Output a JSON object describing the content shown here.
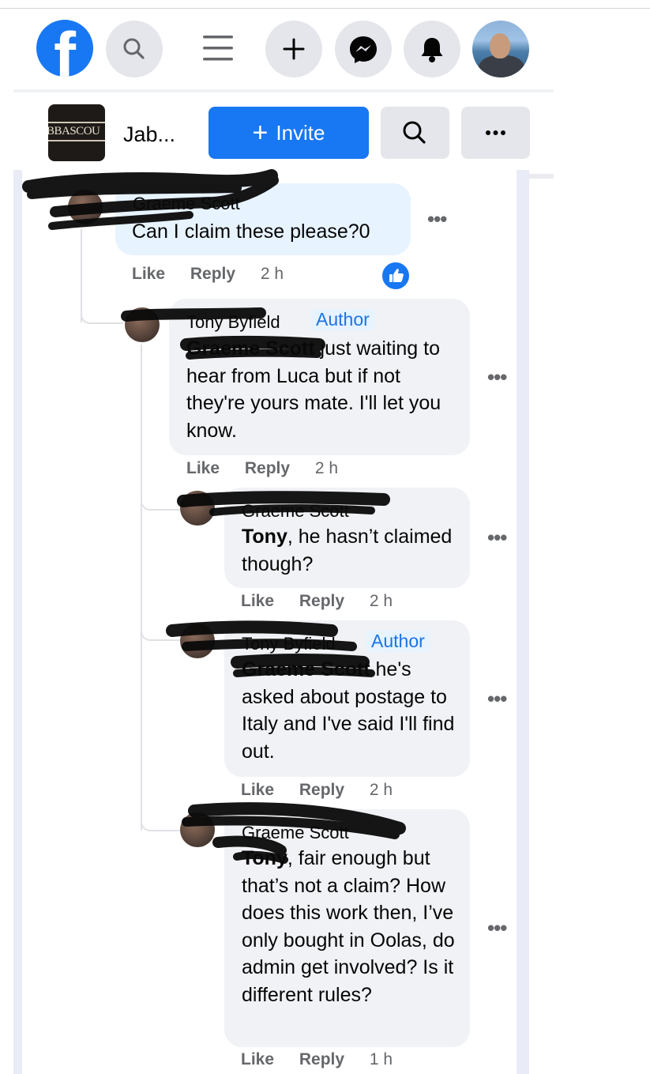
{
  "topbar": {
    "logo_letter": "f"
  },
  "group": {
    "thumb_text": "BBASCOU",
    "name": "Jab...",
    "invite_label": "Invite"
  },
  "comments": [
    {
      "author": "Graeme Scott",
      "text": "Can I claim these please?0",
      "actions": {
        "like": "Like",
        "reply": "Reply",
        "time": "2 h"
      }
    },
    {
      "author": "Tony Byfield",
      "badge": "Author",
      "mention": "Graeme Scott",
      "text": " just waiting to hear from Luca but if not they're yours mate. I'll let you know.",
      "actions": {
        "like": "Like",
        "reply": "Reply",
        "time": "2 h"
      }
    },
    {
      "author": "Graeme Scott",
      "mention": "Tony",
      "text": ", he hasn’t claimed though?",
      "actions": {
        "like": "Like",
        "reply": "Reply",
        "time": "2 h"
      }
    },
    {
      "author": "Tony Byfield",
      "badge": "Author",
      "mention": "Graeme Scott",
      "text": " he's asked about postage to Italy and I've said I'll find out.",
      "actions": {
        "like": "Like",
        "reply": "Reply",
        "time": "2 h"
      }
    },
    {
      "author": "Graeme Scott",
      "mention": "Tony",
      "text": ", fair enough but that’s not a claim? How does this work then, I’ve only bought in Oolas, do admin get involved? Is it different rules?",
      "actions": {
        "like": "Like",
        "reply": "Reply",
        "time": "1 h"
      }
    }
  ],
  "icons": {
    "search": "search-icon",
    "menu": "menu-icon",
    "create": "plus-icon",
    "messenger": "messenger-icon",
    "notifications": "bell-icon",
    "more": "more-icon",
    "like_badge": "thumbs-up-icon"
  },
  "colors": {
    "brand": "#1877f2",
    "bubble": "#f0f2f5",
    "own_bubble": "#e7f3ff",
    "meta": "#65676b"
  }
}
